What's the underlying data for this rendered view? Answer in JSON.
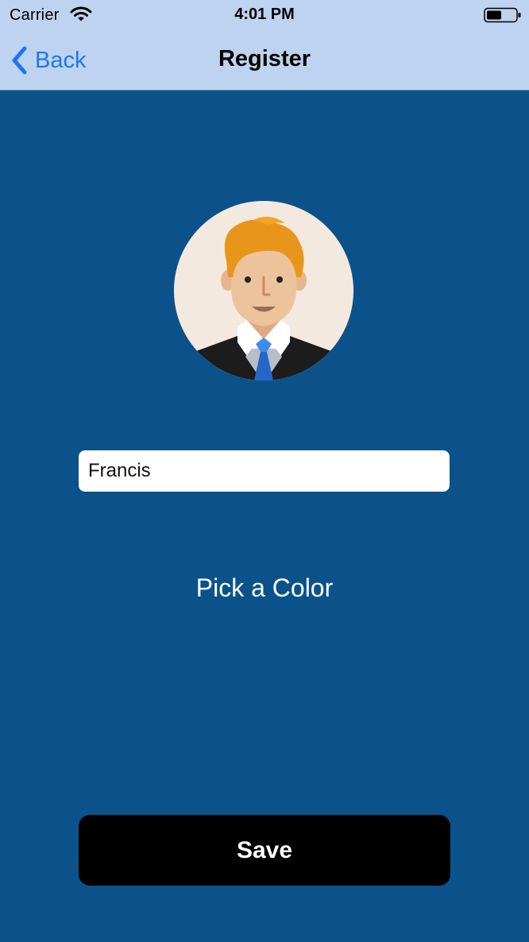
{
  "status_bar": {
    "carrier": "Carrier",
    "time": "4:01 PM"
  },
  "nav": {
    "back_label": "Back",
    "title": "Register"
  },
  "form": {
    "name_value": "Francis",
    "pick_color_label": "Pick a Color",
    "save_label": "Save"
  },
  "colors": {
    "background": "#0b528b",
    "nav_bar": "#bed3ef",
    "accent": "#1f76f0",
    "button": "#000000"
  },
  "icons": {
    "back": "chevron-left-icon",
    "wifi": "wifi-icon",
    "battery": "battery-icon",
    "avatar": "businessman-avatar"
  }
}
